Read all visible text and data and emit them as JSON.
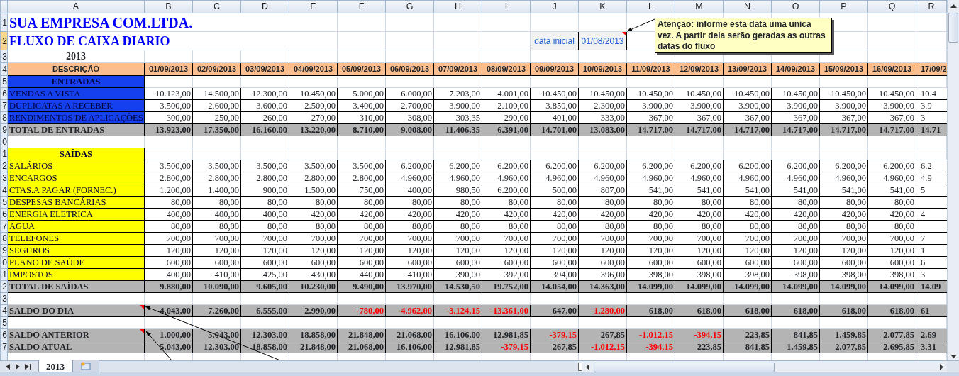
{
  "columns": [
    "A",
    "B",
    "C",
    "D",
    "E",
    "F",
    "G",
    "H",
    "I",
    "J",
    "K",
    "L",
    "M",
    "N",
    "O",
    "P",
    "Q",
    "R"
  ],
  "row_numbers": [
    {
      "label": "1",
      "selected": false
    },
    {
      "label": "2",
      "selected": true
    },
    {
      "label": "3",
      "selected": false
    },
    {
      "label": "4",
      "selected": false
    },
    {
      "label": "5",
      "selected": false
    },
    {
      "label": "6",
      "selected": false
    },
    {
      "label": "7",
      "selected": false
    },
    {
      "label": "8",
      "selected": false
    },
    {
      "label": "9",
      "selected": false
    },
    {
      "label": "0",
      "selected": false
    },
    {
      "label": "1",
      "selected": false
    },
    {
      "label": "2",
      "selected": false
    },
    {
      "label": "3",
      "selected": false
    },
    {
      "label": "4",
      "selected": false
    },
    {
      "label": "5",
      "selected": false
    },
    {
      "label": "6",
      "selected": false
    },
    {
      "label": "7",
      "selected": false
    },
    {
      "label": "8",
      "selected": false
    },
    {
      "label": "9",
      "selected": false
    },
    {
      "label": "0",
      "selected": false
    },
    {
      "label": "1",
      "selected": false
    },
    {
      "label": "2",
      "selected": false
    },
    {
      "label": "3",
      "selected": false
    },
    {
      "label": "4",
      "selected": false
    },
    {
      "label": "5",
      "selected": false
    },
    {
      "label": "6",
      "selected": false
    },
    {
      "label": "7",
      "selected": false
    }
  ],
  "title": "SUA EMPRESA COM.LTDA.",
  "subtitle": "FLUXO DE CAIXA DIARIO",
  "year": "2013",
  "start_date": {
    "label": "data inicial",
    "value": "01/08/2013",
    "note": true
  },
  "comment": "Atenção: informe esta data uma unica vez. A partir dela serão geradas as outras datas do fluxo",
  "header": {
    "label": "DESCRIÇÃO",
    "dates": [
      "01/09/2013",
      "02/09/2013",
      "03/09/2013",
      "04/09/2013",
      "05/09/2013",
      "06/09/2013",
      "07/09/2013",
      "08/09/2013",
      "09/09/2013",
      "10/09/2013",
      "11/09/2013",
      "12/09/2013",
      "13/09/2013",
      "14/09/2013",
      "15/09/2013",
      "16/09/2013",
      "17/09/2"
    ]
  },
  "rows": [
    {
      "kind": "section",
      "color": "#1440ee",
      "label": "ENTRADAS",
      "note": false
    },
    {
      "kind": "item",
      "color": "#1440ee",
      "label": "VENDAS A VISTA",
      "note": false,
      "values": [
        "10.123,00",
        "14.500,00",
        "12.300,00",
        "10.450,00",
        "5.000,00",
        "6.000,00",
        "7.203,00",
        "4.001,00",
        "10.450,00",
        "10.450,00",
        "10.450,00",
        "10.450,00",
        "10.450,00",
        "10.450,00",
        "10.450,00",
        "10.450,00",
        "10.4"
      ]
    },
    {
      "kind": "item",
      "color": "#1440ee",
      "label": "DUPLICATAS A RECEBER",
      "note": false,
      "values": [
        "3.500,00",
        "2.600,00",
        "3.600,00",
        "2.500,00",
        "3.400,00",
        "2.700,00",
        "3.900,00",
        "2.100,00",
        "3.850,00",
        "2.300,00",
        "3.900,00",
        "3.900,00",
        "3.900,00",
        "3.900,00",
        "3.900,00",
        "3.900,00",
        "3.9"
      ]
    },
    {
      "kind": "item",
      "color": "#1440ee",
      "label": "RENDIMENTOS DE APLICAÇÕES",
      "note": false,
      "values": [
        "300,00",
        "250,00",
        "260,00",
        "270,00",
        "310,00",
        "308,00",
        "303,35",
        "290,00",
        "401,00",
        "333,00",
        "367,00",
        "367,00",
        "367,00",
        "367,00",
        "367,00",
        "367,00",
        "3"
      ]
    },
    {
      "kind": "total",
      "label": "TOTAL DE ENTRADAS",
      "note": false,
      "values": [
        "13.923,00",
        "17.350,00",
        "16.160,00",
        "13.220,00",
        "8.710,00",
        "9.008,00",
        "11.406,35",
        "6.391,00",
        "14.701,00",
        "13.083,00",
        "14.717,00",
        "14.717,00",
        "14.717,00",
        "14.717,00",
        "14.717,00",
        "14.717,00",
        "14.71"
      ]
    },
    {
      "kind": "blank",
      "note": false
    },
    {
      "kind": "section",
      "color": "#ffff00",
      "label": "SAÍDAS",
      "note": false
    },
    {
      "kind": "item",
      "color": "#ffff00",
      "label": "SALÁRIOS",
      "note": false,
      "values": [
        "3.500,00",
        "3.500,00",
        "3.500,00",
        "3.500,00",
        "3.500,00",
        "6.200,00",
        "6.200,00",
        "6.200,00",
        "6.200,00",
        "6.200,00",
        "6.200,00",
        "6.200,00",
        "6.200,00",
        "6.200,00",
        "6.200,00",
        "6.200,00",
        "6.2"
      ]
    },
    {
      "kind": "item",
      "color": "#ffff00",
      "label": "ENCARGOS",
      "note": false,
      "values": [
        "2.800,00",
        "2.800,00",
        "2.800,00",
        "2.800,00",
        "2.800,00",
        "4.960,00",
        "4.960,00",
        "4.960,00",
        "4.960,00",
        "4.960,00",
        "4.960,00",
        "4.960,00",
        "4.960,00",
        "4.960,00",
        "4.960,00",
        "4.960,00",
        "4.9"
      ]
    },
    {
      "kind": "item",
      "color": "#ffff00",
      "label": "CTAS.A PAGAR (FORNEC.)",
      "note": false,
      "values": [
        "1.200,00",
        "1.400,00",
        "900,00",
        "1.500,00",
        "750,00",
        "400,00",
        "980,50",
        "6.200,00",
        "500,00",
        "807,00",
        "541,00",
        "541,00",
        "541,00",
        "541,00",
        "541,00",
        "541,00",
        "5"
      ]
    },
    {
      "kind": "item",
      "color": "#ffff00",
      "label": "DESPESAS BANCÁRIAS",
      "note": false,
      "values": [
        "80,00",
        "80,00",
        "80,00",
        "80,00",
        "80,00",
        "80,00",
        "80,00",
        "80,00",
        "80,00",
        "80,00",
        "80,00",
        "80,00",
        "80,00",
        "80,00",
        "80,00",
        "80,00"
      ]
    },
    {
      "kind": "item",
      "color": "#ffff00",
      "label": "ENERGIA ELETRICA",
      "note": false,
      "values": [
        "400,00",
        "400,00",
        "400,00",
        "420,00",
        "420,00",
        "420,00",
        "420,00",
        "420,00",
        "420,00",
        "420,00",
        "420,00",
        "420,00",
        "420,00",
        "420,00",
        "420,00",
        "420,00",
        "4"
      ]
    },
    {
      "kind": "item",
      "color": "#ffff00",
      "label": "AGUA",
      "note": false,
      "values": [
        "80,00",
        "80,00",
        "80,00",
        "80,00",
        "80,00",
        "80,00",
        "80,00",
        "80,00",
        "80,00",
        "80,00",
        "80,00",
        "80,00",
        "80,00",
        "80,00",
        "80,00",
        "80,00"
      ]
    },
    {
      "kind": "item",
      "color": "#ffff00",
      "label": "TELEFONES",
      "note": false,
      "values": [
        "700,00",
        "700,00",
        "700,00",
        "700,00",
        "700,00",
        "700,00",
        "700,00",
        "700,00",
        "700,00",
        "700,00",
        "700,00",
        "700,00",
        "700,00",
        "700,00",
        "700,00",
        "700,00",
        "7"
      ]
    },
    {
      "kind": "item",
      "color": "#ffff00",
      "label": "SEGUROS",
      "note": false,
      "values": [
        "120,00",
        "120,00",
        "120,00",
        "120,00",
        "120,00",
        "120,00",
        "120,00",
        "120,00",
        "120,00",
        "120,00",
        "120,00",
        "120,00",
        "120,00",
        "120,00",
        "120,00",
        "120,00",
        "1"
      ]
    },
    {
      "kind": "item",
      "color": "#ffff00",
      "label": "PLANO DE SAÚDE",
      "note": false,
      "values": [
        "600,00",
        "600,00",
        "600,00",
        "600,00",
        "600,00",
        "600,00",
        "600,00",
        "600,00",
        "600,00",
        "600,00",
        "600,00",
        "600,00",
        "600,00",
        "600,00",
        "600,00",
        "600,00",
        "6"
      ]
    },
    {
      "kind": "item",
      "color": "#ffff00",
      "label": "IMPOSTOS",
      "note": false,
      "values": [
        "400,00",
        "410,00",
        "425,00",
        "430,00",
        "440,00",
        "410,00",
        "390,00",
        "392,00",
        "394,00",
        "396,00",
        "398,00",
        "398,00",
        "398,00",
        "398,00",
        "398,00",
        "398,00",
        "3"
      ]
    },
    {
      "kind": "total",
      "label": "TOTAL DE SAÍDAS",
      "note": false,
      "values": [
        "9.880,00",
        "10.090,00",
        "9.605,00",
        "10.230,00",
        "9.490,00",
        "13.970,00",
        "14.530,50",
        "19.752,00",
        "14.054,00",
        "14.363,00",
        "14.099,00",
        "14.099,00",
        "14.099,00",
        "14.099,00",
        "14.099,00",
        "14.099,00",
        "14.09"
      ]
    },
    {
      "kind": "blank",
      "note": false
    },
    {
      "kind": "total",
      "label": "SALDO DO DIA",
      "note": true,
      "values": [
        "4.043,00",
        "7.260,00",
        "6.555,00",
        "2.990,00",
        "-780,00",
        "-4.962,00",
        "-3.124,15",
        "-13.361,00",
        "647,00",
        "-1.280,00",
        "618,00",
        "618,00",
        "618,00",
        "618,00",
        "618,00",
        "618,00",
        "61"
      ],
      "red": [
        false,
        false,
        false,
        false,
        true,
        true,
        true,
        true,
        false,
        true,
        false,
        false,
        false,
        false,
        false,
        false,
        false
      ]
    },
    {
      "kind": "blank",
      "note": false
    },
    {
      "kind": "total",
      "label": "SALDO ANTERIOR",
      "note": true,
      "values": [
        "1.000,00",
        "5.043,00",
        "12.303,00",
        "18.858,00",
        "21.848,00",
        "21.068,00",
        "16.106,00",
        "12.981,85",
        "-379,15",
        "267,85",
        "-1.012,15",
        "-394,15",
        "223,85",
        "841,85",
        "1.459,85",
        "2.077,85",
        "2.69"
      ],
      "red": [
        false,
        false,
        false,
        false,
        false,
        false,
        false,
        false,
        true,
        false,
        true,
        true,
        false,
        false,
        false,
        false,
        false
      ]
    },
    {
      "kind": "total",
      "label": "SALDO ATUAL",
      "note": false,
      "values": [
        "5.043,00",
        "12.303,00",
        "18.858,00",
        "21.848,00",
        "21.068,00",
        "16.106,00",
        "12.981,85",
        "-379,15",
        "267,85",
        "-1.012,15",
        "-394,15",
        "223,85",
        "841,85",
        "1.459,85",
        "2.077,85",
        "2.695,85",
        "3.31"
      ],
      "red": [
        false,
        false,
        false,
        false,
        false,
        false,
        false,
        true,
        false,
        true,
        true,
        false,
        false,
        false,
        false,
        false,
        false
      ]
    },
    {
      "kind": "blank",
      "note": false
    }
  ],
  "sheet_tabs": [
    {
      "label": "2013",
      "selected": true
    }
  ]
}
